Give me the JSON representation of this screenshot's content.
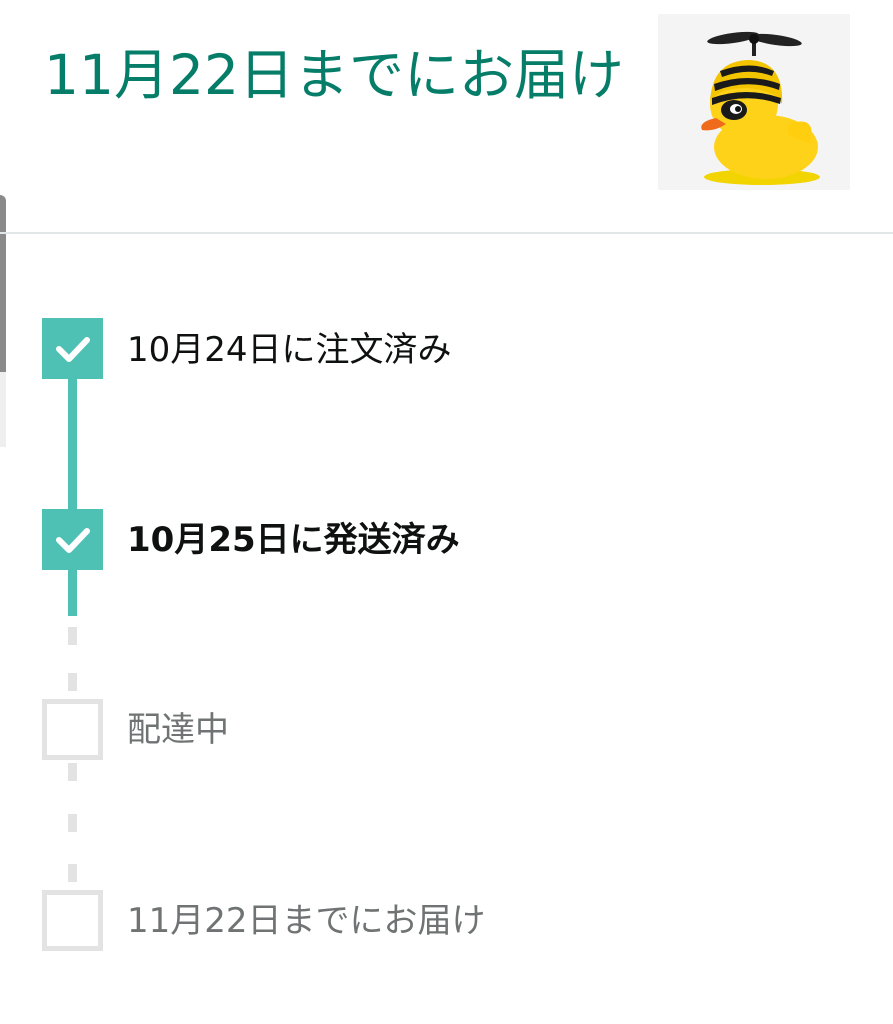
{
  "delivery": {
    "title": "11月22日までにお届け"
  },
  "product": {
    "image_icon": "rubber-duck-with-helmet-propeller"
  },
  "tracking": {
    "steps": [
      {
        "label": "10月24日に注文済み",
        "status": "done"
      },
      {
        "label": "10月25日に発送済み",
        "status": "current"
      },
      {
        "label": "配達中",
        "status": "pending"
      },
      {
        "label": "11月22日までにお届け",
        "status": "pending"
      }
    ]
  },
  "colors": {
    "title": "#067d68",
    "done": "#4fc1b4",
    "pending": "#e3e3e3"
  }
}
